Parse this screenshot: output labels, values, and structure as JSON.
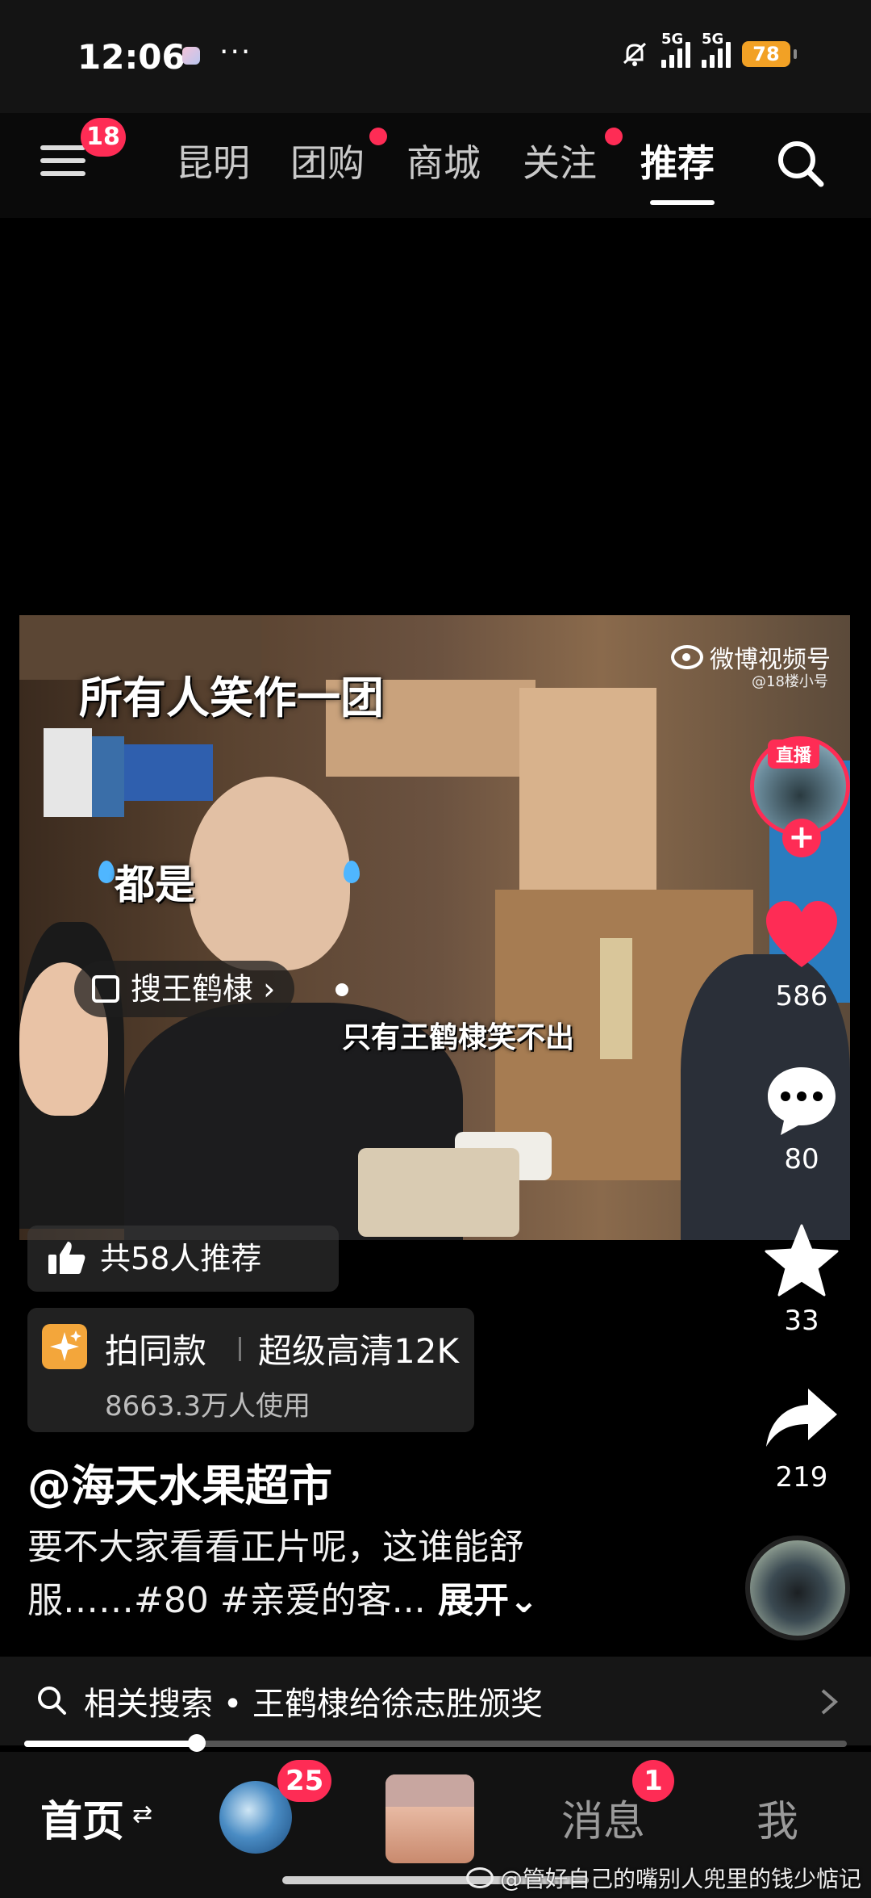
{
  "status_bar": {
    "time": "12:06",
    "dots": "···",
    "signal1_label": "5G",
    "signal2_label": "5G",
    "battery": "78"
  },
  "top_nav": {
    "menu_badge": "18",
    "tabs": [
      {
        "label": "昆明",
        "active": false,
        "dot": false
      },
      {
        "label": "团购",
        "active": false,
        "dot": true
      },
      {
        "label": "商城",
        "active": false,
        "dot": false
      },
      {
        "label": "关注",
        "active": false,
        "dot": true
      },
      {
        "label": "推荐",
        "active": true,
        "dot": false
      }
    ]
  },
  "video": {
    "caption_top": "所有人笑作一团",
    "caption_mid": "都是",
    "caption_bottom": "只有王鹤棣笑不出",
    "source_logo": "微博视频号",
    "source_account": "@18楼小号",
    "search_pill": "搜王鹤棣 ›"
  },
  "right_rail": {
    "live_label": "直播",
    "follow_symbol": "+",
    "likes": "586",
    "comments": "80",
    "favorites": "33",
    "shares": "219"
  },
  "info": {
    "recommend": "共58人推荐",
    "effect_title": "拍同款",
    "effect_name": "超级高清12K",
    "effect_users": "8663.3万人使用",
    "author": "@海天水果超市",
    "description": "要不大家看看正片呢，这谁能舒服……#80 #亲爱的客...",
    "expand": " 展开⌄"
  },
  "related": {
    "text": "相关搜索 • 王鹤棣给徐志胜颁奖"
  },
  "progress": {
    "fraction": 0.21
  },
  "bottom_nav": {
    "home": "首页",
    "home_icon": "⇄",
    "friend_badge": "25",
    "messages": "消息",
    "messages_badge": "1",
    "me": "我"
  },
  "watermark": {
    "text": "@管好自己的嘴别人兜里的钱少惦记"
  },
  "colors": {
    "accent": "#fe2c55",
    "background": "#000000",
    "battery": "#f2a125"
  }
}
